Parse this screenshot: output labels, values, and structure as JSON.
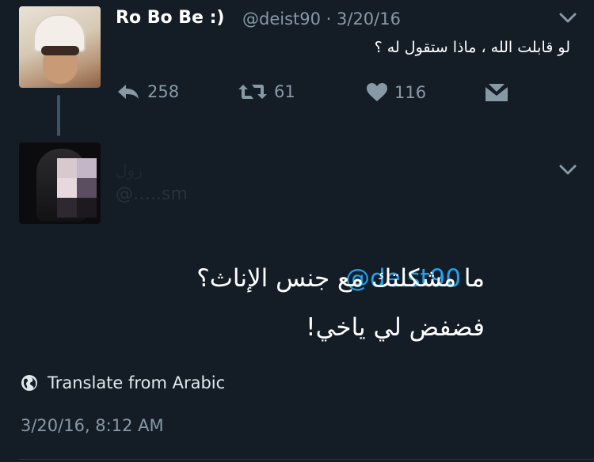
{
  "parent_tweet": {
    "display_name": "Ro Bo Be :)",
    "handle_date": "@deist90 · 3/20/16",
    "text": "لو قابلت الله ، ماذا ستقول له ؟",
    "reply_count": "258",
    "retweet_count": "61",
    "like_count": "116"
  },
  "reply_tweet": {
    "display_name": "زول",
    "handle": "@…..sm",
    "mention": "@deist90",
    "text_line1": "ما مشكلتك مع جنس الإناث؟",
    "text_line2": "فضفض لي ياخي!",
    "translate_label": "Translate from Arabic",
    "timestamp": "3/20/16, 8:12 AM"
  },
  "colors": {
    "background": "#141d26",
    "secondary_text": "#8899a6",
    "link": "#1da1f2"
  },
  "icons": {
    "reply": "reply-icon",
    "retweet": "retweet-icon",
    "like": "heart-icon",
    "dm": "envelope-icon",
    "more": "chevron-down-icon",
    "globe": "globe-icon"
  }
}
